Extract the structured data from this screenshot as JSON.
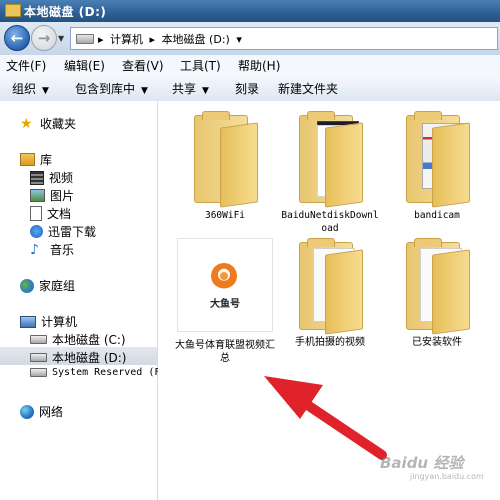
{
  "window": {
    "title": "本地磁盘 (D:)"
  },
  "address": {
    "crumbs": [
      "计算机",
      "本地磁盘 (D:)"
    ],
    "separator": "▸",
    "drop": "▾"
  },
  "menu": [
    "文件(F)",
    "编辑(E)",
    "查看(V)",
    "工具(T)",
    "帮助(H)"
  ],
  "toolbar": [
    {
      "label": "组织",
      "dropdown": true
    },
    {
      "label": "包含到库中",
      "dropdown": true
    },
    {
      "label": "共享",
      "dropdown": true
    },
    {
      "label": "刻录",
      "dropdown": false
    },
    {
      "label": "新建文件夹",
      "dropdown": false
    }
  ],
  "sidebar": {
    "favorites": "收藏夹",
    "library": "库",
    "library_items": [
      "视频",
      "图片",
      "文档",
      "迅雷下载",
      "音乐"
    ],
    "homegroup": "家庭组",
    "computer": "计算机",
    "drives": [
      "本地磁盘 (C:)",
      "本地磁盘 (D:)",
      "System Reserved (F"
    ],
    "selected_drive": "本地磁盘 (D:)",
    "network": "网络"
  },
  "items": [
    {
      "name": "360WiFi",
      "kind": "folder"
    },
    {
      "name": "BaiduNetdiskDownload",
      "kind": "folder-dark"
    },
    {
      "name": "bandicam",
      "kind": "folder-screenshot"
    },
    {
      "name": "大鱼号体育联盟视频汇总",
      "kind": "image",
      "logo_text": "大鱼号"
    },
    {
      "name": "手机拍摄的视频",
      "kind": "folder-open"
    },
    {
      "name": "已安装软件",
      "kind": "folder-open"
    }
  ],
  "watermark": {
    "text": "Baidu 经验",
    "sub": "jingyan.baidu.com"
  },
  "colors": {
    "arrow": "#e0222a",
    "titlebar": "#2d5f93",
    "folder": "#f2d58a"
  }
}
